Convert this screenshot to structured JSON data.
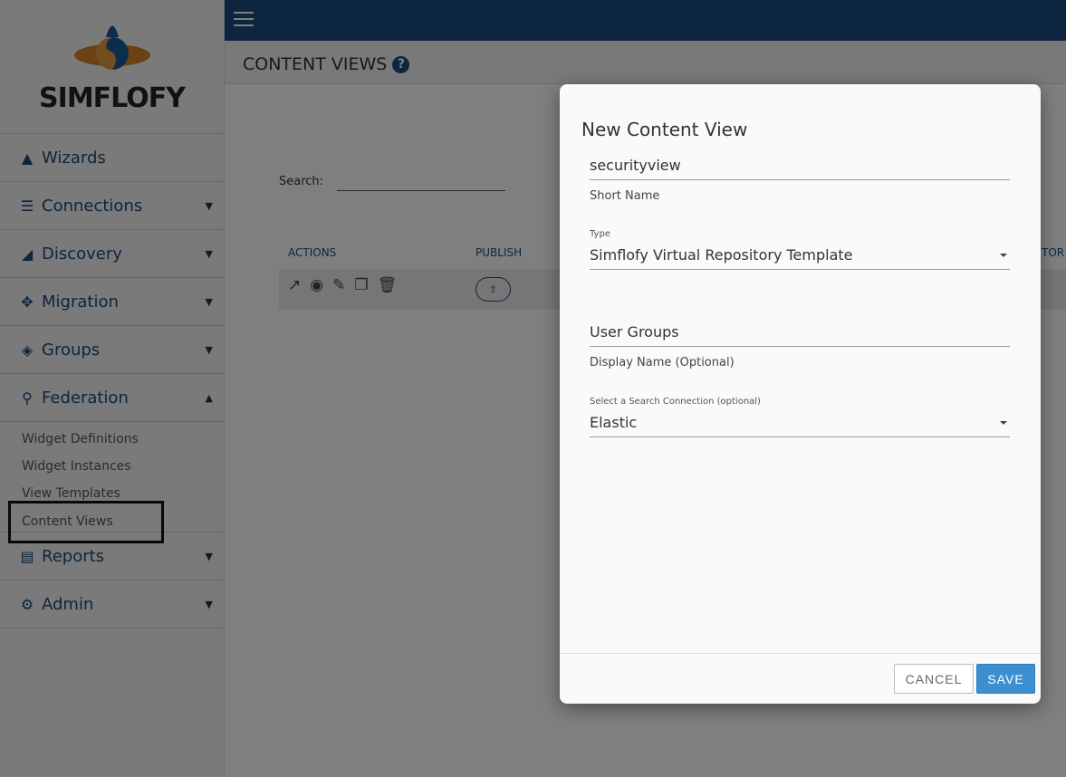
{
  "logo": {
    "text": "SIMFLOFY"
  },
  "sidebar": {
    "items": [
      {
        "label": "Wizards",
        "icon": "wizard-hat-icon"
      },
      {
        "label": "Connections",
        "icon": "database-icon"
      },
      {
        "label": "Discovery",
        "icon": "area-chart-icon"
      },
      {
        "label": "Migration",
        "icon": "arrows-move-icon"
      },
      {
        "label": "Groups",
        "icon": "layers-icon"
      },
      {
        "label": "Federation",
        "icon": "search-icon"
      },
      {
        "label": "Reports",
        "icon": "file-icon"
      },
      {
        "label": "Admin",
        "icon": "users-cog-icon"
      }
    ],
    "federation_sub": [
      "Widget Definitions",
      "Widget Instances",
      "View Templates",
      "Content Views"
    ]
  },
  "header": {
    "title": "CONTENT VIEWS",
    "help": "?"
  },
  "main": {
    "search_label": "Search:",
    "search_value": "",
    "columns": [
      "ACTIONS",
      "PUBLISH",
      "TOR"
    ]
  },
  "modal": {
    "title": "New Content View",
    "short_name_value": "securityview",
    "short_name_label": "Short Name",
    "type_label": "Type",
    "type_value": "Simflofy Virtual Repository Template",
    "display_name_value": "User Groups",
    "display_name_label": "Display Name (Optional)",
    "search_conn_label": "Select a Search Connection (optional)",
    "search_conn_value": "Elastic",
    "cancel": "CANCEL",
    "save": "SAVE"
  },
  "colors": {
    "brand": "#1b4a7c",
    "save": "#3c8fd0"
  }
}
